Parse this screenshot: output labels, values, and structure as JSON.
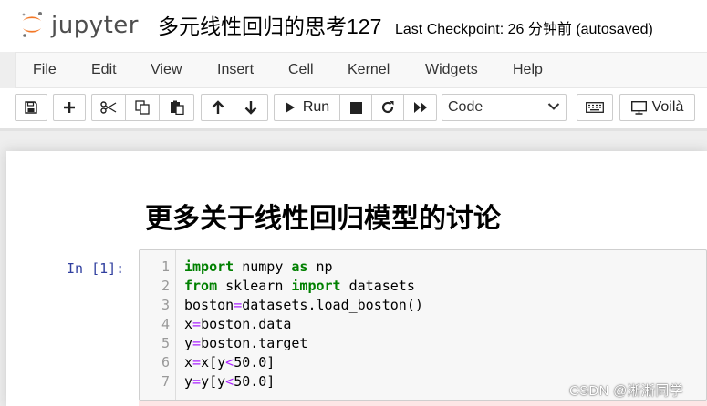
{
  "header": {
    "logo_text": "jupyter",
    "notebook_title": "多元线性回归的思考127",
    "checkpoint": "Last Checkpoint: 26 分钟前   (autosaved)"
  },
  "menu": [
    "File",
    "Edit",
    "View",
    "Insert",
    "Cell",
    "Kernel",
    "Widgets",
    "Help"
  ],
  "toolbar": {
    "run_label": "Run",
    "cell_type": "Code",
    "voila_label": "Voilà",
    "icons": [
      "save-icon",
      "plus-icon",
      "scissors-icon",
      "copy-icon",
      "paste-icon",
      "arrow-up-icon",
      "arrow-down-icon",
      "play-icon",
      "stop-icon",
      "restart-icon",
      "fast-forward-icon",
      "keyboard-icon",
      "monitor-icon"
    ]
  },
  "notebook": {
    "heading": "更多关于线性回归模型的讨论",
    "cell": {
      "prompt": "In  [1]:",
      "line_numbers": [
        "1",
        "2",
        "3",
        "4",
        "5",
        "6",
        "7"
      ],
      "lines": [
        "import numpy as np",
        "from sklearn import datasets",
        "boston=datasets.load_boston()",
        "x=boston.data",
        "y=boston.target",
        "x=x[y<50.0]",
        "y=y[y<50.0]"
      ]
    }
  },
  "watermark": "CSDN @淅淅同学",
  "colors": {
    "logo_orange": "#f37726",
    "prompt_blue": "#303f9f",
    "keyword_green": "#008000",
    "operator_purple": "#aa22ff"
  }
}
